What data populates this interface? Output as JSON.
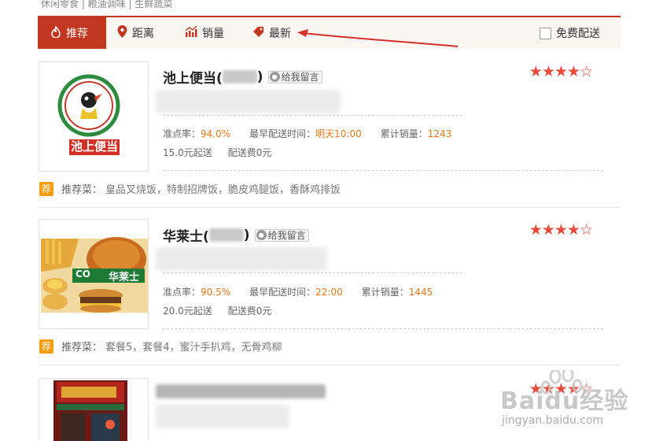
{
  "breadcrumb": "休闲零食 | 粮油调味 | 生鲜蔬菜",
  "sort": {
    "items": [
      {
        "label": "推荐",
        "icon": "flame-icon"
      },
      {
        "label": "距离",
        "icon": "location-pin-icon"
      },
      {
        "label": "销量",
        "icon": "trend-chart-icon"
      },
      {
        "label": "最新",
        "icon": "price-tag-icon"
      }
    ],
    "free_delivery": "免费配送"
  },
  "shops": [
    {
      "name": "池上便当(",
      "name_suffix": ")",
      "message": "给我留言",
      "rating": 4,
      "logo_text": "池上便当",
      "stats": [
        {
          "label": "准点率：",
          "value": "94.0%"
        },
        {
          "label": "最早配送时间：",
          "value": "明天10:00"
        },
        {
          "label": "累计销量：",
          "value": "1243"
        }
      ],
      "min_order": "15.0元起送",
      "delivery_fee": "配送费0元",
      "recommend_badge": "荐",
      "recommend_title": "推荐菜：",
      "recommend_items": "皇品叉烧饭，特制招牌饭，脆皮鸡腿饭，香酥鸡排饭"
    },
    {
      "name": "华莱士(",
      "name_suffix": ")",
      "message": "给我留言",
      "rating": 4,
      "logo_text": "华莱士",
      "stats": [
        {
          "label": "准点率：",
          "value": "90.5%"
        },
        {
          "label": "最早配送时间：",
          "value": "22:00"
        },
        {
          "label": "累计销量：",
          "value": "1445"
        }
      ],
      "min_order": "20.0元起送",
      "delivery_fee": "配送费0元",
      "recommend_badge": "荐",
      "recommend_title": "推荐菜：",
      "recommend_items": "套餐5，套餐4，蜜汁手扒鸡，无骨鸡柳"
    },
    {
      "rating": 4
    }
  ],
  "watermark": {
    "brand": "Baidu经验",
    "url": "jingyan.baidu.com"
  },
  "colors": {
    "accent": "#c1371f",
    "star": "#e84b3c",
    "value": "#e8781c",
    "badge": "#f39c12"
  }
}
